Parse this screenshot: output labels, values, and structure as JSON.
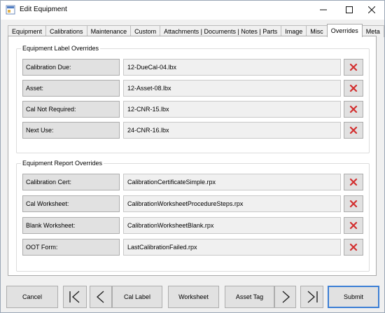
{
  "window": {
    "title": "Edit Equipment"
  },
  "tabs": [
    {
      "label": "Equipment"
    },
    {
      "label": "Calibrations"
    },
    {
      "label": "Maintenance"
    },
    {
      "label": "Custom"
    },
    {
      "label": "Attachments | Documents | Notes | Parts"
    },
    {
      "label": "Image"
    },
    {
      "label": "Misc"
    },
    {
      "label": "Overrides",
      "active": true
    },
    {
      "label": "Meta"
    }
  ],
  "label_overrides": {
    "title": "Equipment Label Overrides",
    "rows": [
      {
        "label": "Calibration Due:",
        "value": "12-DueCal-04.lbx"
      },
      {
        "label": "Asset:",
        "value": "12-Asset-08.lbx"
      },
      {
        "label": "Cal Not Required:",
        "value": "12-CNR-15.lbx"
      },
      {
        "label": "Next Use:",
        "value": "24-CNR-16.lbx"
      }
    ]
  },
  "report_overrides": {
    "title": "Equipment Report Overrides",
    "rows": [
      {
        "label": "Calibration Cert:",
        "value": "CalibrationCertificateSimple.rpx"
      },
      {
        "label": "Cal Worksheet:",
        "value": "CalibrationWorksheetProcedureSteps.rpx"
      },
      {
        "label": "Blank Worksheet:",
        "value": "CalibrationWorksheetBlank.rpx"
      },
      {
        "label": "OOT Form:",
        "value": "LastCalibrationFailed.rpx"
      }
    ]
  },
  "footer": {
    "cancel": "Cancel",
    "cal_label": "Cal Label",
    "worksheet": "Worksheet",
    "asset_tag": "Asset Tag",
    "submit": "Submit"
  },
  "colors": {
    "delete_icon": "#d32f2f",
    "accent": "#3c7fd5"
  }
}
